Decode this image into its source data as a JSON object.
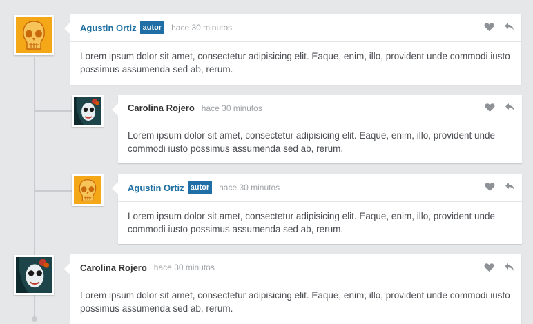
{
  "comments": [
    {
      "name": "Agustin Ortiz",
      "badge": "autor",
      "time": "hace 30 minutos",
      "text": "Lorem ipsum dolor sit amet, consectetur adipisicing elit. Eaque, enim, illo, provident unde commodi iusto possimus assumenda sed ab, rerum."
    },
    {
      "name": "Carolina Rojero",
      "time": "hace 30 minutos",
      "text": "Lorem ipsum dolor sit amet, consectetur adipisicing elit. Eaque, enim, illo, provident unde commodi iusto possimus assumenda sed ab, rerum."
    },
    {
      "name": "Agustin Ortiz",
      "badge": "autor",
      "time": "hace 30 minutos",
      "text": "Lorem ipsum dolor sit amet, consectetur adipisicing elit. Eaque, enim, illo, provident unde commodi iusto possimus assumenda sed ab, rerum."
    },
    {
      "name": "Carolina Rojero",
      "time": "hace 30 minutos",
      "text": "Lorem ipsum dolor sit amet, consectetur adipisicing elit. Eaque, enim, illo, provident unde commodi iusto possimus assumenda sed ab, rerum."
    }
  ],
  "icons": {
    "like": "heart-icon",
    "reply": "reply-arrow-icon"
  },
  "colors": {
    "author_name": "#1f6fa1",
    "badge_bg": "#1f6ea6",
    "background": "#e6e7e9"
  }
}
